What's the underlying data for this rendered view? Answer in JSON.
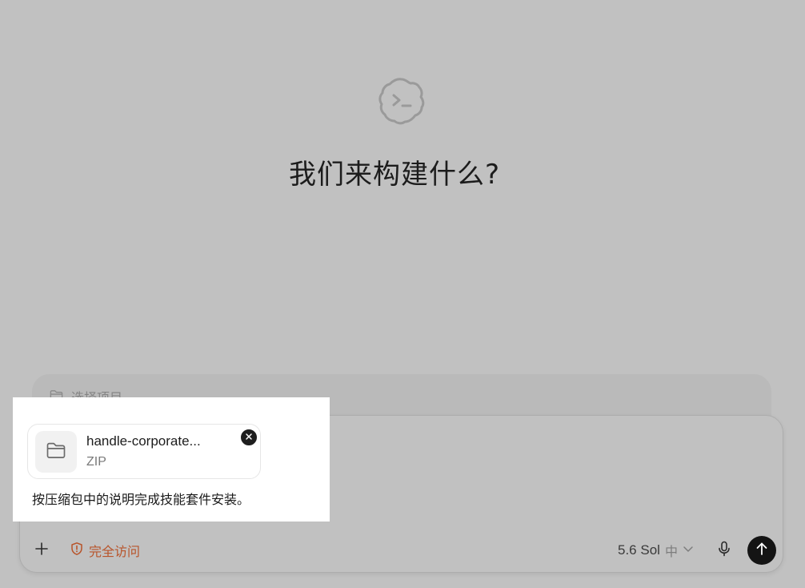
{
  "hero": {
    "logo_icon": "codex-cloud-terminal-icon",
    "title": "我们来构建什么?"
  },
  "project_selector": {
    "icon": "folder-icon",
    "placeholder": "选择项目"
  },
  "composer": {
    "attachment": {
      "name": "handle-corporate...",
      "type": "ZIP",
      "icon": "folder-icon",
      "remove_icon": "close-icon"
    },
    "prompt": "按压缩包中的说明完成技能套件安装。",
    "toolbar": {
      "add_icon": "plus-icon",
      "access_label": "完全访问",
      "access_icon": "shield-alert-icon",
      "model_name": "5.6 Sol",
      "model_level": "中",
      "mic_icon": "microphone-icon",
      "send_icon": "arrow-up-icon"
    }
  },
  "colors": {
    "background": "#c1c1c1",
    "accent_warning": "#b8542a",
    "send_button": "#141414"
  }
}
